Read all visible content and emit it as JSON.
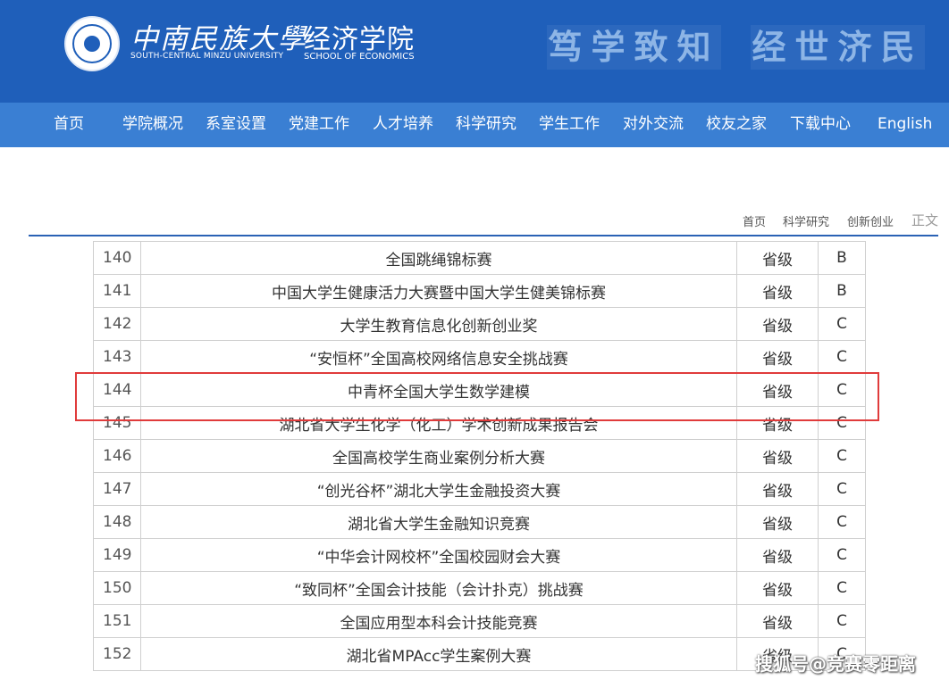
{
  "header": {
    "university_cn": "中南民族大學",
    "university_en": "SOUTH-CENTRAL MINZU UNIVERSITY",
    "school_cn": "经济学院",
    "school_en": "SCHOOL OF ECONOMICS",
    "motto_left": "笃学致知",
    "motto_right": "经世济民",
    "brand_color": "#1f5fba"
  },
  "nav": {
    "items": [
      "首页",
      "学院概况",
      "系室设置",
      "党建工作",
      "人才培养",
      "科学研究",
      "学生工作",
      "对外交流",
      "校友之家",
      "下载中心",
      "English"
    ],
    "bar_color": "#3a7fd3"
  },
  "breadcrumb": {
    "items": [
      "首页",
      "科学研究",
      "创新创业"
    ],
    "current": "正文"
  },
  "table": {
    "rows": [
      {
        "no": "140",
        "name": "全国跳绳锦标赛",
        "level": "省级",
        "grade": "B"
      },
      {
        "no": "141",
        "name": "中国大学生健康活力大赛暨中国大学生健美锦标赛",
        "level": "省级",
        "grade": "B"
      },
      {
        "no": "142",
        "name": "大学生教育信息化创新创业奖",
        "level": "省级",
        "grade": "C"
      },
      {
        "no": "143",
        "name": "“安恒杯”全国高校网络信息安全挑战赛",
        "level": "省级",
        "grade": "C"
      },
      {
        "no": "144",
        "name": "中青杯全国大学生数学建模",
        "level": "省级",
        "grade": "C"
      },
      {
        "no": "145",
        "name": "湖北省大学生化学（化工）学术创新成果报告会",
        "level": "省级",
        "grade": "C"
      },
      {
        "no": "146",
        "name": "全国高校学生商业案例分析大赛",
        "level": "省级",
        "grade": "C"
      },
      {
        "no": "147",
        "name": "“创光谷杯”湖北大学生金融投资大赛",
        "level": "省级",
        "grade": "C"
      },
      {
        "no": "148",
        "name": "湖北省大学生金融知识竞赛",
        "level": "省级",
        "grade": "C"
      },
      {
        "no": "149",
        "name": "“中华会计网校杯”全国校园财会大赛",
        "level": "省级",
        "grade": "C"
      },
      {
        "no": "150",
        "name": "“致同杯”全国会计技能（会计扑克）挑战赛",
        "level": "省级",
        "grade": "C"
      },
      {
        "no": "151",
        "name": "全国应用型本科会计技能竞赛",
        "level": "省级",
        "grade": "C"
      },
      {
        "no": "152",
        "name": "湖北省MPAcc学生案例大赛",
        "level": "省级",
        "grade": "C"
      }
    ],
    "highlighted_no": "144",
    "highlight_color": "#e03b3b"
  },
  "watermark": "搜狐号@竞赛零距离"
}
